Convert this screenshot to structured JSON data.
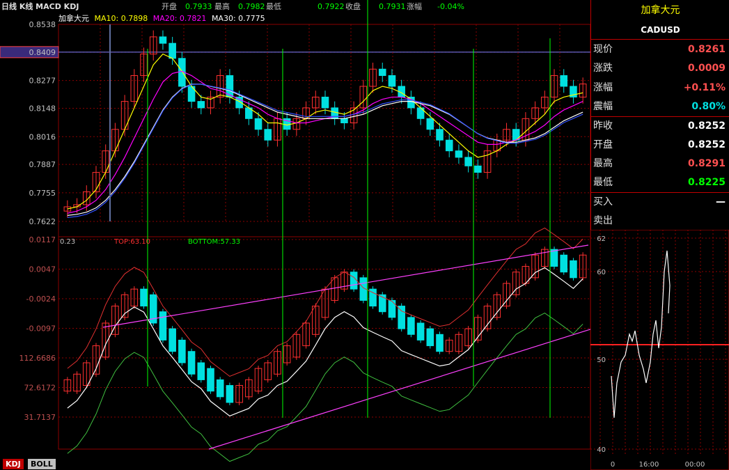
{
  "header": {
    "title": "日线 K线 MACD KDJ",
    "open_label": "开盘",
    "open": "0.7933",
    "high_label": "最高",
    "high": "0.7982",
    "low_label": "最低",
    "low": "0.7922",
    "close_label": "收盘",
    "close": "0.7931",
    "chg_label": "涨幅",
    "chg": "-0.04%"
  },
  "legend": {
    "name": "加拿大元",
    "ma10": "MA10: 0.7898",
    "ma20": "MA20: 0.7821",
    "ma30": "MA30: 0.7775"
  },
  "colors": {
    "up": "#ff3030",
    "down": "#00e0e0",
    "ma10": "#ffffff",
    "ma20": "#ff00ff",
    "ma30": "#ffff00",
    "ma60": "#3050ff",
    "grid": "#8b0000",
    "signal": "#00ff00",
    "channel": "#ff40ff"
  },
  "price_panel": {
    "price_ticks": [
      "0.8538",
      "0.8409",
      "0.8277",
      "0.8148",
      "0.8016",
      "0.7887",
      "0.7755",
      "0.7622"
    ],
    "highlight_tick": "0.8409",
    "ylim": [
      0.7622,
      0.8538
    ]
  },
  "kdj_panel": {
    "top_label": "TOP:63.10",
    "bottom_label": "BOTTOM:57.33",
    "val_label": "0.23",
    "left_ticks": [
      "0.0117",
      "0.0047",
      "-0.0024",
      "-0.0097",
      "112.6686",
      "72.6172",
      "31.7137"
    ],
    "ylim": [
      30,
      65
    ]
  },
  "intraday": {
    "right_ticks": [
      "62",
      "60",
      "50",
      "40"
    ],
    "time_ticks": [
      "0",
      "16:00",
      "00:00"
    ]
  },
  "quote": {
    "title": "加拿大元",
    "code": "CADUSD",
    "rows": [
      {
        "k": "现价",
        "v": "0.8261",
        "c": "#ff5050"
      },
      {
        "k": "涨跌",
        "v": "0.0009",
        "c": "#ff5050"
      },
      {
        "k": "涨幅",
        "v": "+0.11%",
        "c": "#ff5050"
      },
      {
        "k": "震幅",
        "v": "0.80%",
        "c": "#00e0e0"
      },
      {
        "k": "昨收",
        "v": "0.8252",
        "c": "#ffffff"
      },
      {
        "k": "开盘",
        "v": "0.8252",
        "c": "#ffffff"
      },
      {
        "k": "最高",
        "v": "0.8291",
        "c": "#ff5050"
      },
      {
        "k": "最低",
        "v": "0.8225",
        "c": "#00ff00"
      },
      {
        "k": "买入",
        "v": "—",
        "c": "#ffffff"
      },
      {
        "k": "卖出",
        "v": "",
        "c": "#ffffff"
      }
    ]
  },
  "tabs": [
    {
      "label": "KDJ",
      "active": true
    },
    {
      "label": "BOLL",
      "active": false
    }
  ],
  "chart_data": {
    "type": "line",
    "series": [
      {
        "name": "加拿大元",
        "values": [
          0.769,
          0.77,
          0.776,
          0.785,
          0.795,
          0.805,
          0.818,
          0.83,
          0.84,
          0.848,
          0.845,
          0.838,
          0.825,
          0.818,
          0.815,
          0.82,
          0.83,
          0.82,
          0.815,
          0.81,
          0.805,
          0.8,
          0.81,
          0.805,
          0.81,
          0.815,
          0.82,
          0.815,
          0.81,
          0.808,
          0.815,
          0.825,
          0.833,
          0.83,
          0.825,
          0.82,
          0.815,
          0.81,
          0.805,
          0.8,
          0.795,
          0.792,
          0.788,
          0.785,
          0.795,
          0.8,
          0.805,
          0.8,
          0.81,
          0.815,
          0.82,
          0.83,
          0.825,
          0.82,
          0.8261
        ]
      },
      {
        "name": "MA10",
        "values": [
          0.768,
          0.769,
          0.772,
          0.777,
          0.785,
          0.795,
          0.805,
          0.815,
          0.825,
          0.835,
          0.84,
          0.838,
          0.832,
          0.825,
          0.82,
          0.819,
          0.821,
          0.82,
          0.818,
          0.815,
          0.812,
          0.808,
          0.808,
          0.807,
          0.808,
          0.81,
          0.813,
          0.814,
          0.813,
          0.812,
          0.814,
          0.818,
          0.823,
          0.825,
          0.824,
          0.822,
          0.819,
          0.815,
          0.811,
          0.807,
          0.803,
          0.799,
          0.795,
          0.792,
          0.793,
          0.795,
          0.798,
          0.8,
          0.804,
          0.808,
          0.812,
          0.818,
          0.82,
          0.821,
          0.822
        ]
      },
      {
        "name": "MA20",
        "values": [
          0.766,
          0.767,
          0.769,
          0.772,
          0.777,
          0.784,
          0.792,
          0.801,
          0.81,
          0.819,
          0.827,
          0.831,
          0.832,
          0.83,
          0.827,
          0.824,
          0.823,
          0.821,
          0.819,
          0.817,
          0.815,
          0.812,
          0.81,
          0.809,
          0.808,
          0.808,
          0.809,
          0.81,
          0.811,
          0.811,
          0.812,
          0.814,
          0.817,
          0.819,
          0.82,
          0.82,
          0.819,
          0.817,
          0.814,
          0.811,
          0.808,
          0.805,
          0.802,
          0.799,
          0.798,
          0.798,
          0.799,
          0.8,
          0.802,
          0.804,
          0.807,
          0.811,
          0.814,
          0.816,
          0.818
        ]
      },
      {
        "name": "MA30",
        "values": [
          0.765,
          0.7655,
          0.7665,
          0.7685,
          0.772,
          0.777,
          0.783,
          0.79,
          0.798,
          0.806,
          0.814,
          0.82,
          0.824,
          0.826,
          0.826,
          0.825,
          0.824,
          0.823,
          0.821,
          0.819,
          0.817,
          0.815,
          0.813,
          0.812,
          0.811,
          0.81,
          0.81,
          0.81,
          0.81,
          0.81,
          0.811,
          0.812,
          0.814,
          0.816,
          0.817,
          0.818,
          0.818,
          0.817,
          0.816,
          0.814,
          0.812,
          0.809,
          0.806,
          0.803,
          0.801,
          0.8,
          0.799,
          0.799,
          0.8,
          0.801,
          0.803,
          0.806,
          0.809,
          0.811,
          0.813
        ]
      },
      {
        "name": "KDJ-K",
        "values": [
          40,
          41,
          43,
          46,
          50,
          53,
          55,
          56,
          55,
          52,
          49,
          47,
          45,
          43,
          42,
          40,
          39,
          38,
          39,
          40,
          42,
          43,
          45,
          46,
          48,
          50,
          53,
          56,
          58,
          59,
          58,
          56,
          55,
          54,
          53,
          51,
          50,
          49,
          48,
          47,
          47,
          48,
          49,
          51,
          53,
          55,
          57,
          59,
          60,
          62,
          63,
          62,
          61,
          60,
          62
        ]
      }
    ],
    "ylim": [
      0.7622,
      0.8538
    ]
  }
}
